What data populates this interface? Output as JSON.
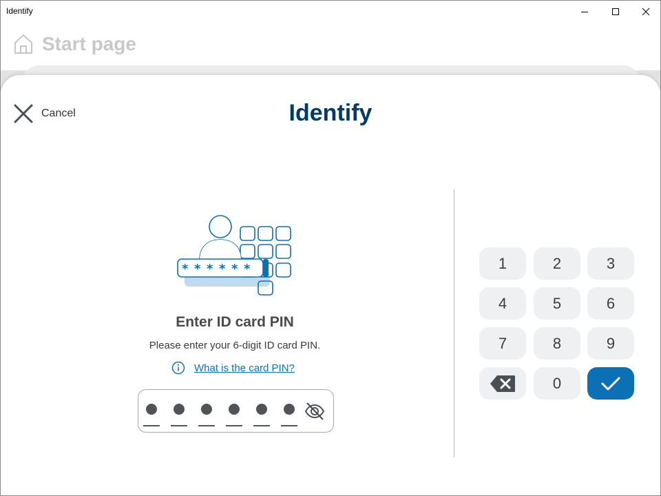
{
  "window": {
    "title": "Identify"
  },
  "background": {
    "page_title": "Start page"
  },
  "dialog": {
    "cancel_label": "Cancel",
    "title": "Identify",
    "pin_heading": "Enter ID card PIN",
    "pin_description": "Please enter your 6-digit ID card PIN.",
    "help_link": "What is the card PIN?",
    "pin_length": 6,
    "pin_entered_digits": 6
  },
  "keypad": {
    "digits": [
      "1",
      "2",
      "3",
      "4",
      "5",
      "6",
      "7",
      "8",
      "9",
      "0"
    ],
    "backspace_icon": "backspace-icon",
    "confirm_icon": "checkmark-icon"
  },
  "colors": {
    "title": "#003c66",
    "accent": "#0b70b4",
    "link": "#0a74b5",
    "key_bg": "#eff0f1",
    "pin_dot": "#4f5459"
  }
}
